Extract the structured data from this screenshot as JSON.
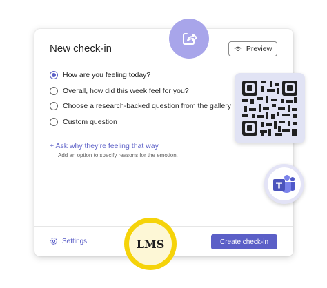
{
  "card": {
    "title": "New check-in",
    "preview_label": "Preview",
    "options": [
      {
        "label": "How are you feeling today?",
        "checked": true
      },
      {
        "label": "Overall, how did this week feel for you?",
        "checked": false
      },
      {
        "label": "Choose a research-backed question from the gallery",
        "checked": false
      },
      {
        "label": "Custom question",
        "checked": false
      }
    ],
    "ask_link": "+ Ask why they’re feeling that way",
    "ask_help": "Add an option to specify reasons for the emotion.",
    "settings_label": "Settings",
    "create_label": "Create check-in"
  },
  "badges": {
    "share_icon": "share-icon",
    "qr_icon": "qr-code-icon",
    "teams_icon": "microsoft-teams-icon",
    "lms_label": "LMS"
  },
  "colors": {
    "accent": "#5b5fc7",
    "share_badge": "#a8a5ea",
    "qr_badge": "#e1e3f4",
    "lms_ring": "#f5d30a",
    "lms_fill": "#fdf7d6"
  }
}
